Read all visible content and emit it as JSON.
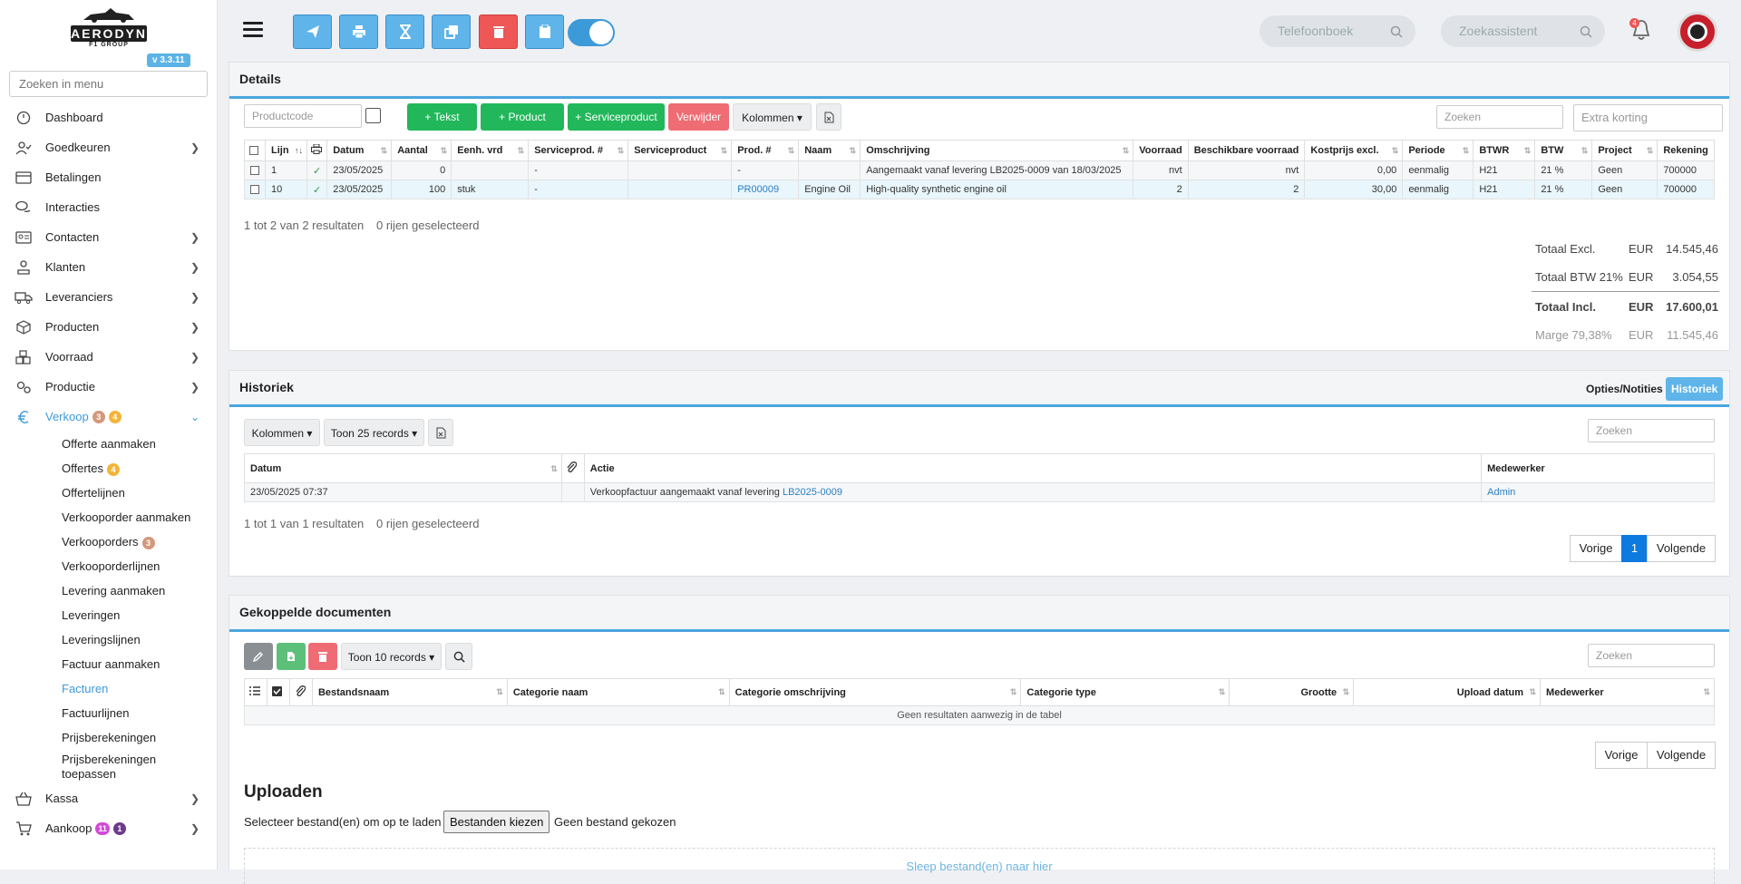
{
  "sidebar": {
    "logo_text": "AERODYN",
    "logo_sub": "F1 GROUP",
    "version": "v 3.3.11",
    "search_placeholder": "Zoeken in menu",
    "items": [
      {
        "label": "Dashboard",
        "icon": "dashboard-icon",
        "chevron": false
      },
      {
        "label": "Goedkeuren",
        "icon": "user-check-icon",
        "chevron": true
      },
      {
        "label": "Betalingen",
        "icon": "payment-icon",
        "chevron": false
      },
      {
        "label": "Interacties",
        "icon": "chat-icon",
        "chevron": false
      },
      {
        "label": "Contacten",
        "icon": "contact-card-icon",
        "chevron": true
      },
      {
        "label": "Klanten",
        "icon": "customer-icon",
        "chevron": true
      },
      {
        "label": "Leveranciers",
        "icon": "truck-icon",
        "chevron": true
      },
      {
        "label": "Producten",
        "icon": "box-icon",
        "chevron": true
      },
      {
        "label": "Voorraad",
        "icon": "boxes-icon",
        "chevron": true
      },
      {
        "label": "Productie",
        "icon": "gears-icon",
        "chevron": true
      }
    ],
    "verkoop": {
      "label": "Verkoop",
      "badge1": "3",
      "badge2": "4"
    },
    "sub_items": [
      {
        "label": "Offerte aanmaken",
        "badge": ""
      },
      {
        "label": "Offertes",
        "badge": "4"
      },
      {
        "label": "Offertelijnen",
        "badge": ""
      },
      {
        "label": "Verkooporder aanmaken",
        "badge": ""
      },
      {
        "label": "Verkooporders",
        "badge": "3"
      },
      {
        "label": "Verkooporderlijnen",
        "badge": ""
      },
      {
        "label": "Levering aanmaken",
        "badge": ""
      },
      {
        "label": "Leveringen",
        "badge": ""
      },
      {
        "label": "Leveringslijnen",
        "badge": ""
      },
      {
        "label": "Factuur aanmaken",
        "badge": ""
      },
      {
        "label": "Facturen",
        "badge": ""
      },
      {
        "label": "Factuurlijnen",
        "badge": ""
      },
      {
        "label": "Prijsberekeningen",
        "badge": ""
      }
    ],
    "sub_last_line1": "Prijsberekeningen",
    "sub_last_line2": "toepassen",
    "kassa": "Kassa",
    "aankoop": {
      "label": "Aankoop",
      "badge1": "11",
      "badge2": "1"
    }
  },
  "topbar": {
    "phonebook_placeholder": "Telefoonboek",
    "assistant_placeholder": "Zoekassistent",
    "notif_count": "4"
  },
  "details": {
    "title": "Details",
    "productcode_placeholder": "Productcode",
    "btn_tekst": "+ Tekst",
    "btn_product": "+ Product",
    "btn_service": "+ Serviceproduct",
    "btn_delete": "Verwijder",
    "btn_columns": "Kolommen",
    "search_placeholder": "Zoeken",
    "discount_placeholder": "Extra korting",
    "headers": [
      "Lijn",
      "Datum",
      "Aantal",
      "Eenh. vrd",
      "Serviceprod. #",
      "Serviceproduct",
      "Prod. #",
      "Naam",
      "Omschrijving",
      "Voorraad",
      "Beschikbare voorraad",
      "Kostprijs excl.",
      "Periode",
      "BTWR",
      "BTW",
      "Project",
      "Rekening"
    ],
    "rows": [
      {
        "lijn": "1",
        "datum": "23/05/2025",
        "aantal": "0",
        "eenh": "",
        "sp_nr": "-",
        "sp": "",
        "prod_nr": "-",
        "naam": "",
        "omschr": "Aangemaakt vanaf levering LB2025-0009 van 18/03/2025",
        "voorraad": "nvt",
        "beschikbaar": "nvt",
        "kostprijs": "0,00",
        "periode": "eenmalig",
        "btwr": "H21",
        "btw": "21 %",
        "project": "Geen",
        "rekening": "700000"
      },
      {
        "lijn": "10",
        "datum": "23/05/2025",
        "aantal": "100",
        "eenh": "stuk",
        "sp_nr": "-",
        "sp": "",
        "prod_nr": "PR00009",
        "naam": "Engine Oil",
        "omschr": "High-quality synthetic engine oil",
        "voorraad": "2",
        "beschikbaar": "2",
        "kostprijs": "30,00",
        "periode": "eenmalig",
        "btwr": "H21",
        "btw": "21 %",
        "project": "Geen",
        "rekening": "700000"
      }
    ],
    "result_info": "1 tot 2 van 2 resultaten",
    "selected_info": "0 rijen geselecteerd",
    "totals": [
      {
        "label": "Totaal Excl.",
        "currency": "EUR",
        "value": "14.545,46"
      },
      {
        "label": "Totaal BTW 21%",
        "currency": "EUR",
        "value": "3.054,55"
      },
      {
        "label": "Totaal Incl.",
        "currency": "EUR",
        "value": "17.600,01"
      },
      {
        "label": "Marge 79,38%",
        "currency": "EUR",
        "value": "11.545,46"
      }
    ]
  },
  "historiek": {
    "title": "Historiek",
    "tab_opties": "Opties/Notities",
    "tab_historiek": "Historiek",
    "btn_columns": "Kolommen",
    "btn_records": "Toon 25 records",
    "search_placeholder": "Zoeken",
    "headers": [
      "Datum",
      "Actie",
      "Medewerker"
    ],
    "row": {
      "datum": "23/05/2025 07:37",
      "actie": "Verkoopfactuur aangemaakt vanaf levering ",
      "actie_link": "LB2025-0009",
      "medewerker": "Admin"
    },
    "result_info": "1 tot 1 van 1 resultaten",
    "selected_info": "0 rijen geselecteerd",
    "prev": "Vorige",
    "page": "1",
    "next": "Volgende"
  },
  "documenten": {
    "title": "Gekoppelde documenten",
    "btn_records": "Toon 10 records",
    "search_placeholder": "Zoeken",
    "headers": [
      "Bestandsnaam",
      "Categorie naam",
      "Categorie omschrijving",
      "Categorie type",
      "Grootte",
      "Upload datum",
      "Medewerker"
    ],
    "empty": "Geen resultaten aanwezig in de tabel",
    "prev": "Vorige",
    "next": "Volgende",
    "upload_title": "Uploaden",
    "upload_label": "Selecteer bestand(en) om op te laden",
    "upload_button": "Bestanden kiezen",
    "upload_none": "Geen bestand gekozen",
    "drop_text": "Sleep bestand(en) naar hier"
  },
  "colors": {
    "accent": "#3d9ad9",
    "green": "#21b75a",
    "red": "#ef5656"
  }
}
